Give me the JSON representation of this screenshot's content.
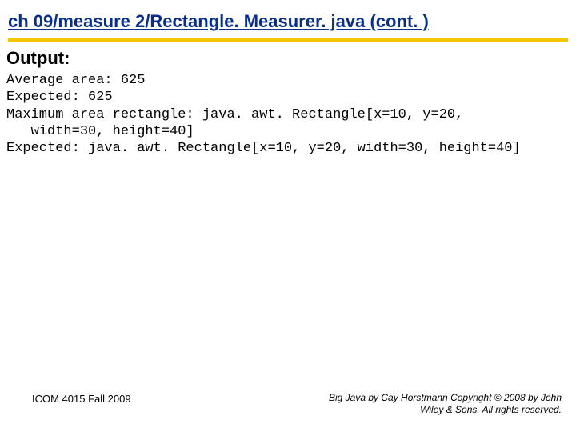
{
  "title": "ch 09/measure 2/Rectangle. Measurer. java  (cont. )",
  "subhead": "Output:",
  "output": "Average area: 625\nExpected: 625\nMaximum area rectangle: java. awt. Rectangle[x=10, y=20,\n   width=30, height=40]\nExpected: java. awt. Rectangle[x=10, y=20, width=30, height=40]",
  "footer_left": "ICOM 4015 Fall 2009",
  "footer_right": "Big Java by Cay Horstmann Copyright © 2008 by John Wiley & Sons.  All rights reserved."
}
